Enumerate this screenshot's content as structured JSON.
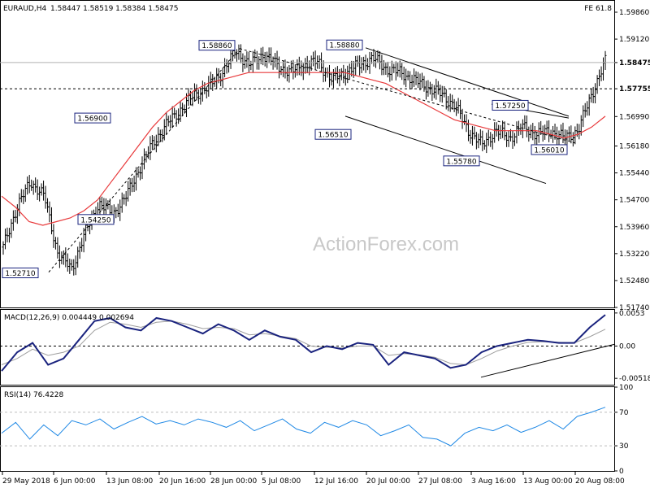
{
  "header": {
    "symbol": "EURAUD,H4",
    "ohlc": "1.58447 1.58519 1.58384 1.58475",
    "fib_tag": "FE 61.8"
  },
  "watermark": "ActionForex.com",
  "colors": {
    "price_bars": "#000000",
    "moving_average": "#e8393b",
    "macd_main": "#1a237e",
    "macd_signal": "#9e9e9e",
    "rsi": "#1e88e5",
    "label_box_border": "#1a237e"
  },
  "chart_data": [
    {
      "type": "line",
      "panel": "price",
      "title": "EURAUD,H4",
      "ylim": [
        1.5174,
        1.5986
      ],
      "y_ticks": [
        "1.59860",
        "1.59120",
        "1.58475",
        "1.57755",
        "1.56990",
        "1.56180",
        "1.55440",
        "1.54700",
        "1.53960",
        "1.53220",
        "1.52480",
        "1.51740"
      ],
      "current_price": "1.58475",
      "horizontal_level": "1.57755",
      "x_ticks": [
        "29 May 2018",
        "6 Jun 00:00",
        "13 Jun 08:00",
        "20 Jun 16:00",
        "28 Jun 00:00",
        "5 Jul 08:00",
        "12 Jul 16:00",
        "20 Jul 00:00",
        "27 Jul 08:00",
        "3 Aug 16:00",
        "13 Aug 00:00",
        "20 Aug 08:00"
      ],
      "annotations": [
        "1.58860",
        "1.58880",
        "1.56900",
        "1.56510",
        "1.57250",
        "1.55780",
        "1.56010",
        "1.54250",
        "1.52710"
      ],
      "series": [
        {
          "values": [
            1.534,
            1.545,
            1.552,
            1.548,
            1.532,
            1.528,
            1.538,
            1.546,
            1.543,
            1.548,
            1.556,
            1.563,
            1.568,
            1.572,
            1.576,
            1.578,
            1.582,
            1.588,
            1.584,
            1.587,
            1.584,
            1.582,
            1.584,
            1.585,
            1.58,
            1.582,
            1.584,
            1.586,
            1.583,
            1.582,
            1.58,
            1.578,
            1.576,
            1.573,
            1.566,
            1.562,
            1.566,
            1.564,
            1.567,
            1.565,
            1.566,
            1.564,
            1.566,
            1.576,
            1.585
          ]
        },
        {
          "values": [
            1.548,
            1.545,
            1.541,
            1.54,
            1.541,
            1.542,
            1.544,
            1.547,
            1.552,
            1.557,
            1.562,
            1.567,
            1.571,
            1.574,
            1.577,
            1.579,
            1.58,
            1.581,
            1.582,
            1.582,
            1.582,
            1.582,
            1.582,
            1.582,
            1.582,
            1.582,
            1.581,
            1.58,
            1.579,
            1.577,
            1.575,
            1.573,
            1.571,
            1.569,
            1.568,
            1.567,
            1.566,
            1.566,
            1.566,
            1.566,
            1.565,
            1.564,
            1.565,
            1.567,
            1.57
          ]
        }
      ]
    },
    {
      "type": "line",
      "panel": "macd",
      "title": "MACD(12,26,9) 0.004449 0.002694",
      "ylim": [
        -0.0062,
        0.0058
      ],
      "y_ticks": [
        "0.0053",
        "0.00",
        "-0.00518"
      ],
      "series": [
        {
          "values": [
            -0.004,
            -0.001,
            0.0005,
            -0.003,
            -0.002,
            0.001,
            0.004,
            0.0045,
            0.003,
            0.0025,
            0.0045,
            0.004,
            0.003,
            0.002,
            0.0035,
            0.0025,
            0.001,
            0.0025,
            0.0015,
            0.001,
            -0.001,
            0.0,
            -0.0005,
            0.0005,
            0.0002,
            -0.003,
            -0.001,
            -0.0015,
            -0.002,
            -0.0035,
            -0.003,
            -0.001,
            0.0,
            0.0005,
            0.001,
            0.0008,
            0.0005,
            0.0005,
            0.003,
            0.005
          ]
        },
        {
          "values": [
            -0.003,
            -0.002,
            -0.0005,
            -0.0015,
            -0.001,
            0.0,
            0.0025,
            0.0038,
            0.0035,
            0.003,
            0.0038,
            0.004,
            0.0035,
            0.0028,
            0.003,
            0.0028,
            0.0018,
            0.002,
            0.0016,
            0.0012,
            0.0,
            -0.0002,
            -0.0003,
            0.0,
            0.0,
            -0.0015,
            -0.0012,
            -0.0014,
            -0.0018,
            -0.0028,
            -0.003,
            -0.002,
            -0.0008,
            0.0,
            0.0006,
            0.0007,
            0.0006,
            0.0005,
            0.0015,
            0.0027
          ]
        }
      ]
    },
    {
      "type": "line",
      "panel": "rsi",
      "title": "RSI(14) 76.4228",
      "ylim": [
        0,
        100
      ],
      "y_ticks": [
        "100",
        "70",
        "30",
        "0"
      ],
      "levels": [
        70,
        30
      ],
      "series": [
        {
          "values": [
            45,
            58,
            38,
            55,
            42,
            60,
            55,
            62,
            50,
            58,
            65,
            56,
            60,
            55,
            62,
            58,
            52,
            60,
            48,
            55,
            62,
            50,
            45,
            58,
            52,
            60,
            55,
            42,
            48,
            55,
            40,
            38,
            30,
            45,
            52,
            48,
            55,
            46,
            52,
            60,
            50,
            65,
            70,
            76
          ]
        }
      ]
    }
  ]
}
